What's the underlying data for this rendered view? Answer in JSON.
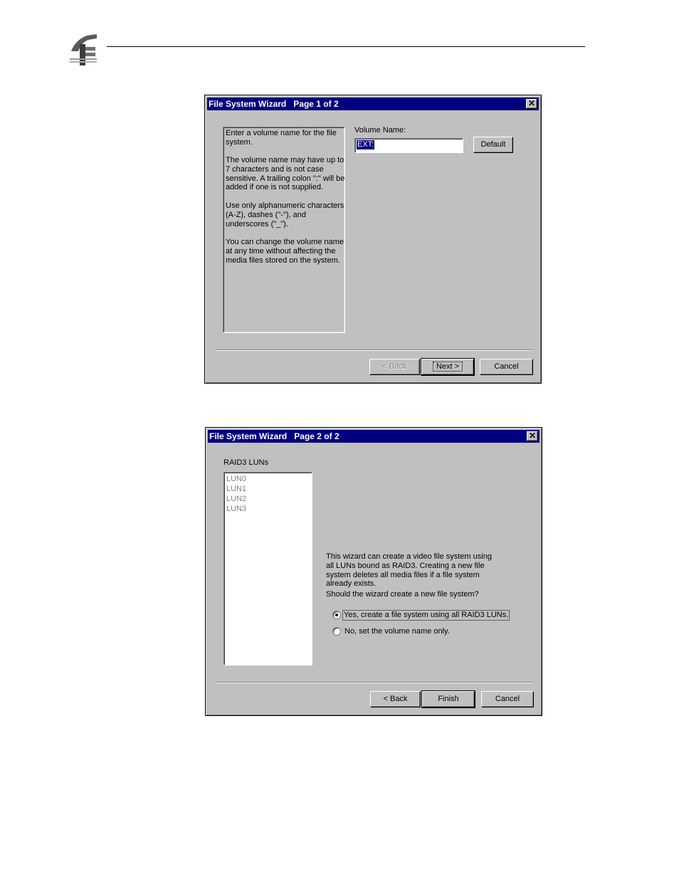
{
  "wizard1": {
    "title": "File System Wizard   Page 1 of 2",
    "help_paragraphs": [
      "Enter a volume name for the file system.",
      "The volume name may have up to 7 characters and is not case sensitive. A trailing colon \":\" will be added if one is not supplied.",
      "Use only alphanumeric characters (A-Z), dashes (\"-\"), and underscores (\"_\").",
      "You can change the volume name at any time without affecting the media files stored on the system."
    ],
    "volume_label": "Volume Name:",
    "volume_value": "EXT:",
    "default_button": "Default",
    "back_button": "< Back",
    "next_button": "Next >",
    "cancel_button": "Cancel"
  },
  "wizard2": {
    "title": "File System Wizard   Page 2 of 2",
    "luns_label": "RAID3 LUNs",
    "luns": [
      "LUN0",
      "LUN1",
      "LUN2",
      "LUN3"
    ],
    "description": "This wizard can create a video file system using all LUNs bound as RAID3.  Creating a new file system deletes all media files if a file system already exists.",
    "question": "Should the wizard create a new file system?",
    "option_yes": "Yes, create a file system using all RAID3 LUNs.",
    "option_no": "No, set the volume name only.",
    "selected_option": "yes",
    "back_button": "< Back",
    "finish_button": "Finish",
    "cancel_button": "Cancel"
  },
  "icons": {
    "logo": "company-logo-icon",
    "close": "close-icon"
  },
  "colors": {
    "titlebar": "#000080",
    "face": "#c0c0c0"
  }
}
